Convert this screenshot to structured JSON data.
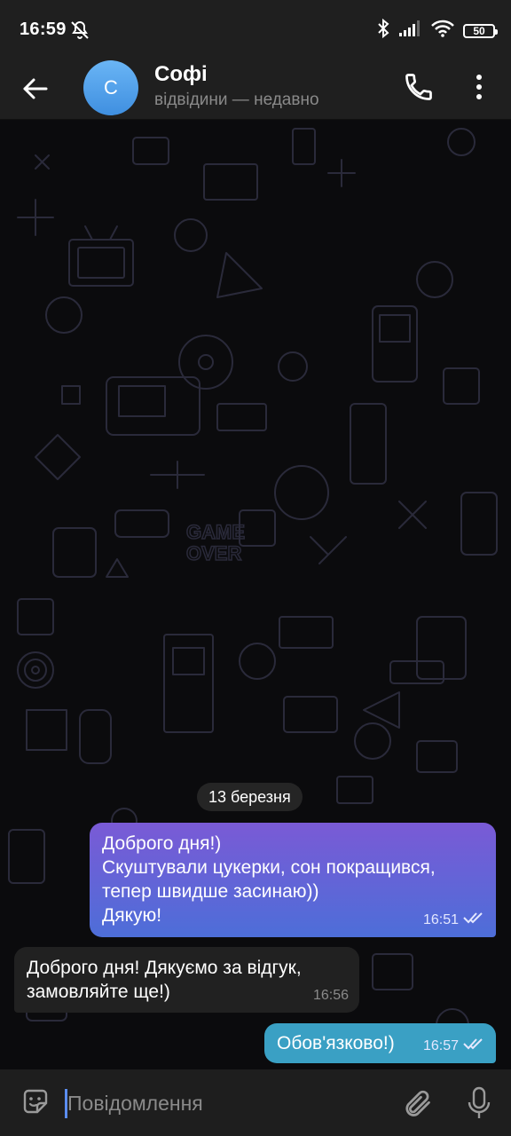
{
  "status_bar": {
    "time": "16:59",
    "battery": "50",
    "icons": [
      "mute-icon",
      "bluetooth-icon",
      "signal-icon",
      "wifi-icon",
      "battery-icon"
    ]
  },
  "header": {
    "avatar_letter": "С",
    "name": "Софі",
    "status": "відвідини — недавно",
    "icons": [
      "back-arrow-icon",
      "phone-icon",
      "more-vertical-icon"
    ]
  },
  "chat": {
    "date": "13 березня",
    "messages": [
      {
        "direction": "outgoing",
        "lines": [
          "Доброго дня!)",
          "Скуштували цукерки, сон покращився,",
          "тепер швидше засинаю))",
          "Дякую!"
        ],
        "time": "16:51",
        "read": true
      },
      {
        "direction": "incoming",
        "lines": [
          "Доброго дня! Дякуємо за відгук,",
          "замовляйте ще!)"
        ],
        "time": "16:56"
      },
      {
        "direction": "outgoing",
        "lines": [
          "Обов'язково!)"
        ],
        "time": "16:57",
        "read": true
      }
    ]
  },
  "input": {
    "placeholder": "Повідомлення",
    "icons": [
      "emoji-sticker-icon",
      "attach-icon",
      "microphone-icon"
    ]
  },
  "colors": {
    "bar_bg": "#1f1f1f",
    "outgoing_gradient_top": "#7a5ad6",
    "outgoing_gradient_bottom": "#4d6ed8",
    "outgoing_short": "#3aa0c4",
    "incoming_bg": "#212121",
    "avatar": "#4a9ae8"
  }
}
